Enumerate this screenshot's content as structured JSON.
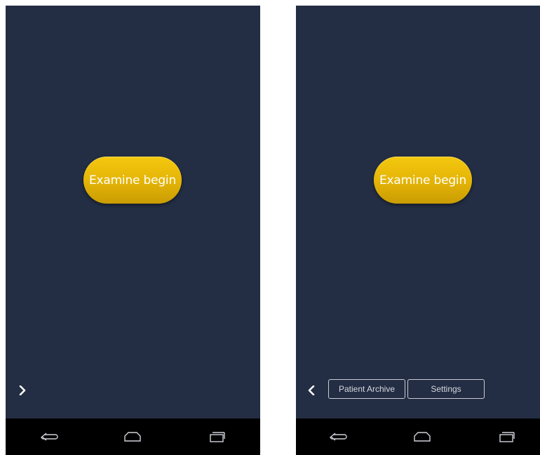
{
  "left_screen": {
    "examine_button_label": "Examine begin",
    "expand_icon": "chevron-right-icon",
    "navbar": {
      "back_icon": "back-icon",
      "home_icon": "home-icon",
      "recents_icon": "recents-icon"
    }
  },
  "right_screen": {
    "examine_button_label": "Examine begin",
    "collapse_icon": "chevron-left-icon",
    "menu": {
      "patient_archive_label": "Patient Archive",
      "settings_label": "Settings"
    },
    "navbar": {
      "back_icon": "back-icon",
      "home_icon": "home-icon",
      "recents_icon": "recents-icon"
    }
  },
  "colors": {
    "screen_background": "#232d43",
    "button_gold": "#e3b306",
    "navbar_background": "#000000",
    "outline": "#c9ccd4"
  }
}
